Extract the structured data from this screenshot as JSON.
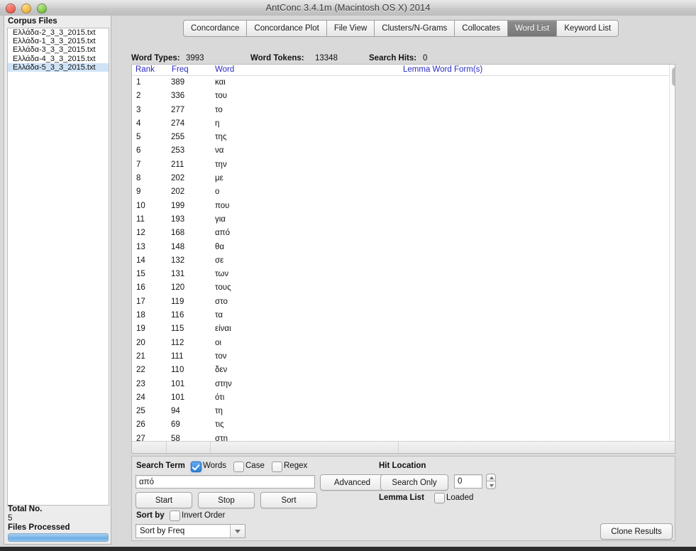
{
  "window": {
    "title": "AntConc 3.4.1m (Macintosh OS X) 2014",
    "traffic_lights": [
      "close-button",
      "minimize-button",
      "maximize-button"
    ]
  },
  "sidebar": {
    "title": "Corpus Files",
    "files": [
      {
        "name": "Ελλάδα-2_3_3_2015.txt",
        "selected": false
      },
      {
        "name": "Ελλάδα-1_3_3_2015.txt",
        "selected": false
      },
      {
        "name": "Ελλάδα-3_3_3_2015.txt",
        "selected": false
      },
      {
        "name": "Ελλάδα-4_3_3_2015.txt",
        "selected": false
      },
      {
        "name": "Ελλάδα-5_3_3_2015.txt",
        "selected": true
      }
    ],
    "total_label": "Total No.",
    "total_value": "5",
    "processed_label": "Files Processed",
    "progress_percent": 100
  },
  "tabs": [
    {
      "label": "Concordance",
      "active": false
    },
    {
      "label": "Concordance Plot",
      "active": false
    },
    {
      "label": "File View",
      "active": false
    },
    {
      "label": "Clusters/N-Grams",
      "active": false
    },
    {
      "label": "Collocates",
      "active": false
    },
    {
      "label": "Word List",
      "active": true
    },
    {
      "label": "Keyword List",
      "active": false
    }
  ],
  "stats": {
    "word_types_label": "Word Types:",
    "word_types_value": "3993",
    "word_tokens_label": "Word Tokens:",
    "word_tokens_value": "13348",
    "search_hits_label": "Search Hits:",
    "search_hits_value": "0"
  },
  "table": {
    "headers": {
      "rank": "Rank",
      "freq": "Freq",
      "word": "Word",
      "lemma": "Lemma Word Form(s)"
    },
    "rows": [
      {
        "rank": "1",
        "freq": "389",
        "word": "και"
      },
      {
        "rank": "2",
        "freq": "336",
        "word": "του"
      },
      {
        "rank": "3",
        "freq": "277",
        "word": "το"
      },
      {
        "rank": "4",
        "freq": "274",
        "word": "η"
      },
      {
        "rank": "5",
        "freq": "255",
        "word": "της"
      },
      {
        "rank": "6",
        "freq": "253",
        "word": "να"
      },
      {
        "rank": "7",
        "freq": "211",
        "word": "την"
      },
      {
        "rank": "8",
        "freq": "202",
        "word": "με"
      },
      {
        "rank": "9",
        "freq": "202",
        "word": "ο"
      },
      {
        "rank": "10",
        "freq": "199",
        "word": "που"
      },
      {
        "rank": "11",
        "freq": "193",
        "word": "για"
      },
      {
        "rank": "12",
        "freq": "168",
        "word": "από"
      },
      {
        "rank": "13",
        "freq": "148",
        "word": "θα"
      },
      {
        "rank": "14",
        "freq": "132",
        "word": "σε"
      },
      {
        "rank": "15",
        "freq": "131",
        "word": "των"
      },
      {
        "rank": "16",
        "freq": "120",
        "word": "τους"
      },
      {
        "rank": "17",
        "freq": "119",
        "word": "στο"
      },
      {
        "rank": "18",
        "freq": "116",
        "word": "τα"
      },
      {
        "rank": "19",
        "freq": "115",
        "word": "είναι"
      },
      {
        "rank": "20",
        "freq": "112",
        "word": "οι"
      },
      {
        "rank": "21",
        "freq": "111",
        "word": "τον"
      },
      {
        "rank": "22",
        "freq": "110",
        "word": "δεν"
      },
      {
        "rank": "23",
        "freq": "101",
        "word": "στην"
      },
      {
        "rank": "24",
        "freq": "101",
        "word": "ότι"
      },
      {
        "rank": "25",
        "freq": "94",
        "word": "τη"
      },
      {
        "rank": "26",
        "freq": "69",
        "word": "τις"
      },
      {
        "rank": "27",
        "freq": "58",
        "word": "στη"
      }
    ]
  },
  "controls": {
    "search_term_label": "Search Term",
    "words_checkbox": {
      "label": "Words",
      "checked": true
    },
    "case_checkbox": {
      "label": "Case",
      "checked": false
    },
    "regex_checkbox": {
      "label": "Regex",
      "checked": false
    },
    "search_input_value": "από",
    "advanced_button": "Advanced",
    "start_button": "Start",
    "stop_button": "Stop",
    "sort_button": "Sort",
    "sort_by_label": "Sort by",
    "invert_order": {
      "label": "Invert Order",
      "checked": false
    },
    "sort_select_value": "Sort by Freq",
    "hit_location_label": "Hit Location",
    "search_only_button": "Search Only",
    "hit_location_value": "0",
    "lemma_list_label": "Lemma List",
    "loaded_checkbox": {
      "label": "Loaded",
      "checked": false
    },
    "clone_results_button": "Clone Results"
  },
  "colors": {
    "header_blue": "#2a2ac0",
    "selection_blue": "#cfe3f7",
    "accent_blue": "#7cb7ea",
    "active_tab": "#777777"
  }
}
